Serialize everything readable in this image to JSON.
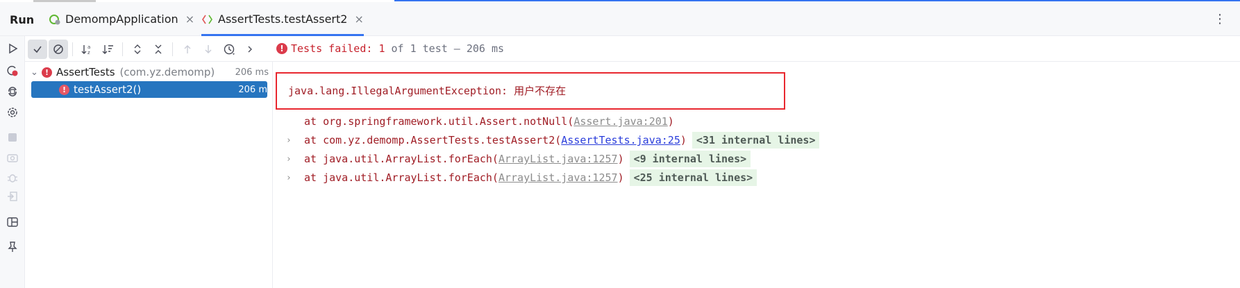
{
  "window": {
    "tool_window_title": "Run",
    "tabs": [
      {
        "label": "DemompApplication",
        "icon": "spring-boot-icon",
        "active": false
      },
      {
        "label": "AssertTests.testAssert2",
        "icon": "test-diamond-icon",
        "active": true
      }
    ],
    "more_icon": "more-vertical-icon"
  },
  "left_toolbar": {
    "icons": [
      "rerun-icon",
      "rerun-failed-icon",
      "toggle-auto-test-icon",
      "settings-icon",
      "stop-icon",
      "screenshot-icon",
      "debug-icon",
      "exit-icon",
      "layout-icon",
      "pin-icon"
    ]
  },
  "test_toolbar": {
    "icons": [
      "show-passed-icon",
      "show-ignored-icon",
      "sort-alpha-icon",
      "sort-duration-icon",
      "expand-all-icon",
      "collapse-all-icon",
      "previous-failed-icon",
      "next-failed-icon",
      "test-history-icon",
      "more-arrow-icon"
    ],
    "status": {
      "prefix": "Tests failed:",
      "failed_count": "1",
      "rest": "of 1 test – 206 ms"
    }
  },
  "tree": {
    "items": [
      {
        "name": "AssertTests",
        "package": "(com.yz.demomp)",
        "duration": "206 ms",
        "status": "failed",
        "selected": false
      },
      {
        "name": "testAssert2()",
        "package": "",
        "duration": "206 m",
        "status": "failed",
        "selected": true
      }
    ]
  },
  "console": {
    "exception": "java.lang.IllegalArgumentException: 用户不存在",
    "frames": [
      {
        "foldable": false,
        "at": "at org.springframework.util.Assert.notNull(",
        "link": "Assert.java:201",
        "link_active": false,
        "suffix": ")",
        "internal": ""
      },
      {
        "foldable": true,
        "at": "at com.yz.demomp.AssertTests.testAssert2(",
        "link": "AssertTests.java:25",
        "link_active": true,
        "suffix": ")",
        "internal": "<31 internal lines>"
      },
      {
        "foldable": true,
        "at": "at java.util.ArrayList.forEach(",
        "link": "ArrayList.java:1257",
        "link_active": false,
        "suffix": ")",
        "internal": "<9 internal lines>"
      },
      {
        "foldable": true,
        "at": "at java.util.ArrayList.forEach(",
        "link": "ArrayList.java:1257",
        "link_active": false,
        "suffix": ")",
        "internal": "<25 internal lines>"
      }
    ]
  },
  "colors": {
    "accent": "#3574f0",
    "selection": "#2675bf",
    "error": "#db3b4b",
    "exception_text": "#a01d25",
    "internal_lines_bg": "#e6f5e6"
  }
}
